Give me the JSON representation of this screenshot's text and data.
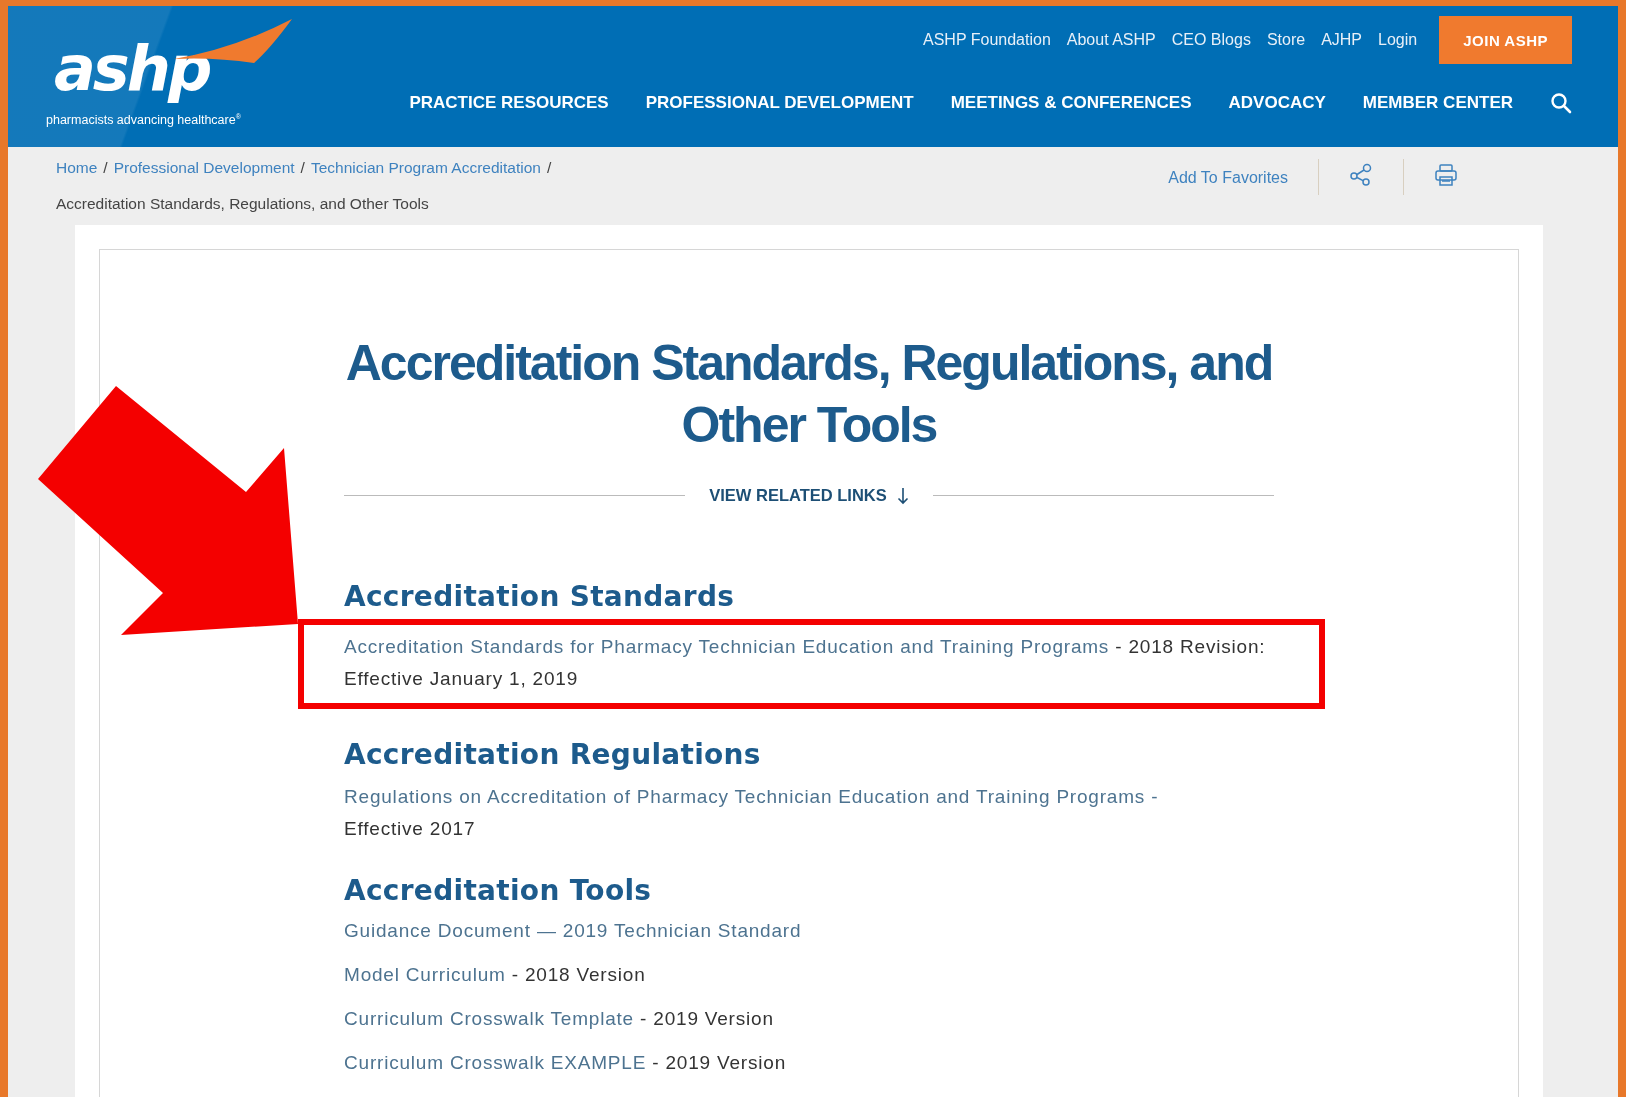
{
  "logo": {
    "wordmark": "ashp",
    "tagline": "pharmacists advancing healthcare$^{®}$"
  },
  "utility_links": [
    "ASHP Foundation",
    "About ASHP",
    "CEO Blogs",
    "Store",
    "AJHP",
    "Login"
  ],
  "join_button": "JOIN ASHP",
  "nav": [
    "PRACTICE RESOURCES",
    "PROFESSIONAL DEVELOPMENT",
    "MEETINGS & CONFERENCES",
    "ADVOCACY",
    "MEMBER CENTER"
  ],
  "breadcrumb": {
    "separator": "/",
    "links": [
      "Home",
      "Professional Development",
      "Technician Program Accreditation"
    ],
    "current": "Accreditation Standards, Regulations, and Other Tools"
  },
  "page_actions": {
    "favorites": "Add To Favorites"
  },
  "title": "Accreditation Standards, Regulations, and Other Tools",
  "related_links_toggle": "VIEW RELATED LINKS",
  "sections": [
    {
      "heading": "Accreditation Standards",
      "items": [
        {
          "link": "Accreditation Standards for Pharmacy Technician Education and Training Programs",
          "suffix": "- 2018 Revision: Effective January 1, 2019",
          "highlighted": true
        }
      ]
    },
    {
      "heading": "Accreditation Regulations",
      "items": [
        {
          "link": "Regulations on Accreditation of Pharmacy Technician Education and Training Programs -",
          "suffix": "Effective 2017",
          "highlighted": false
        }
      ]
    },
    {
      "heading": "Accreditation Tools",
      "items": [
        {
          "link": "Guidance Document — 2019 Technician Standard",
          "highlighted": false
        },
        {
          "link": "Model Curriculum",
          "suffix": "- 2018 Version",
          "highlighted": false
        },
        {
          "link": "Curriculum Crosswalk Template",
          "suffix": "- 2019 Version",
          "highlighted": false
        },
        {
          "link": "Curriculum Crosswalk EXAMPLE",
          "suffix": "- 2019 Version",
          "highlighted": false
        }
      ]
    }
  ]
}
